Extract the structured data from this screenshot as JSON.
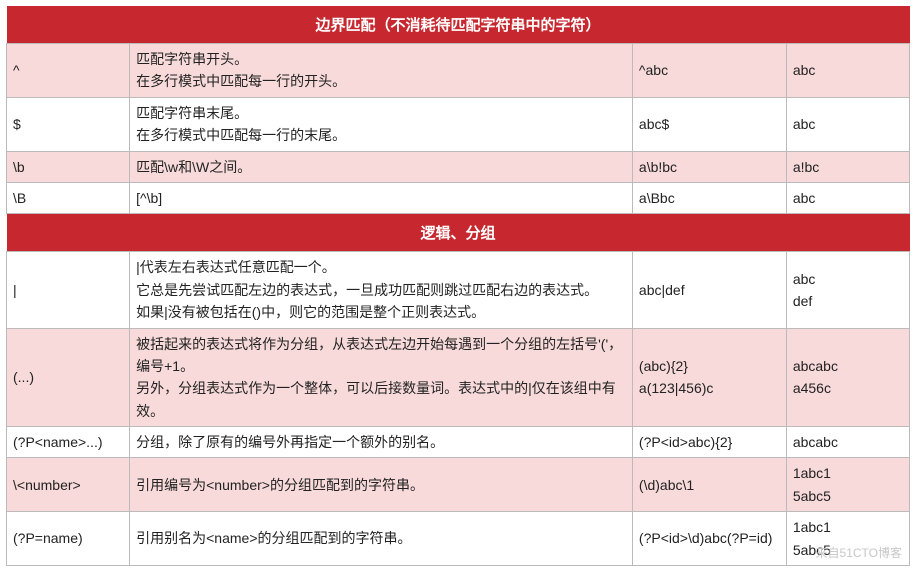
{
  "sections": [
    {
      "header": "边界匹配（不消耗待匹配字符串中的字符）",
      "rows": [
        {
          "shade": "pink",
          "sym": "^",
          "desc": "匹配字符串开头。\n在多行模式中匹配每一行的开头。",
          "ex": "^abc",
          "match": "abc"
        },
        {
          "shade": "white",
          "sym": "$",
          "desc": "匹配字符串末尾。\n在多行模式中匹配每一行的末尾。",
          "ex": "abc$",
          "match": "abc"
        },
        {
          "shade": "pink",
          "sym": "\\b",
          "desc": "匹配\\w和\\W之间。",
          "ex": "a\\b!bc",
          "match": "a!bc"
        },
        {
          "shade": "white",
          "sym": "\\B",
          "desc": "[^\\b]",
          "ex": "a\\Bbc",
          "match": "abc"
        }
      ]
    },
    {
      "header": "逻辑、分组",
      "rows": [
        {
          "shade": "white",
          "sym": "|",
          "desc": "|代表左右表达式任意匹配一个。\n它总是先尝试匹配左边的表达式，一旦成功匹配则跳过匹配右边的表达式。\n如果|没有被包括在()中，则它的范围是整个正则表达式。",
          "ex": "abc|def",
          "match": "abc\ndef"
        },
        {
          "shade": "pink",
          "sym": "(...)",
          "desc": "被括起来的表达式将作为分组，从表达式左边开始每遇到一个分组的左括号'('，编号+1。\n另外，分组表达式作为一个整体，可以后接数量词。表达式中的|仅在该组中有效。",
          "ex": "(abc){2}\na(123|456)c",
          "match": "abcabc\na456c"
        },
        {
          "shade": "white",
          "sym": "(?P<name>...)",
          "desc": "分组，除了原有的编号外再指定一个额外的别名。",
          "ex": "(?P<id>abc){2}",
          "match": "abcabc"
        },
        {
          "shade": "pink",
          "sym": "\\<number>",
          "desc": "引用编号为<number>的分组匹配到的字符串。",
          "ex": "(\\d)abc\\1",
          "match": "1abc1\n5abc5"
        },
        {
          "shade": "white",
          "sym": "(?P=name)",
          "desc": "引用别名为<name>的分组匹配到的字符串。",
          "ex": "(?P<id>\\d)abc(?P=id)",
          "match": "1abc1\n5abc5"
        }
      ]
    }
  ],
  "watermark": "来自51CTO博客"
}
